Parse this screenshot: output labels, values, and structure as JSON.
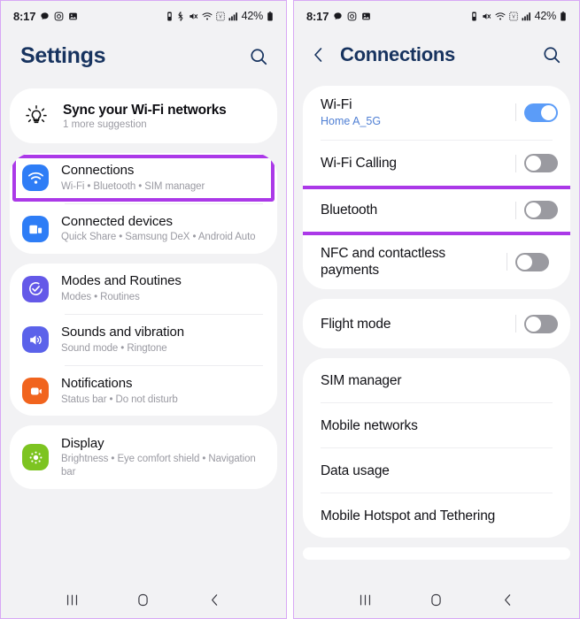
{
  "theme": {
    "accent_highlight": "#ab39e8",
    "panel_border": "#d8a8f5",
    "page_bg": "#f2f2f4",
    "card_bg": "#ffffff",
    "title_color": "#17335f",
    "toggle_on": "#5b9cf8",
    "toggle_off": "#9a9aa0",
    "subtitle_color": "#9a9aa2",
    "link_color": "#4f7fd4"
  },
  "left": {
    "status_bar": {
      "time": "8:17",
      "left_icons": [
        "chat-bubble-icon",
        "instagram-icon",
        "gallery-icon"
      ],
      "right_icons": [
        "alarm-icon",
        "bluetooth-icon",
        "mute-icon",
        "wifi-icon",
        "vpn-icon",
        "signal-bars-icon"
      ],
      "battery_percent": "42%",
      "battery_icon": "battery-icon"
    },
    "app_bar": {
      "title": "Settings",
      "search_icon": "search-icon"
    },
    "suggestion": {
      "icon": "lightbulb-icon",
      "title": "Sync your Wi-Fi networks",
      "subtitle": "1 more suggestion"
    },
    "groups": [
      {
        "rows": [
          {
            "icon": "wifi-icon",
            "icon_color": "#2e7df6",
            "title": "Connections",
            "subtitle": "Wi-Fi  •  Bluetooth  •  SIM manager",
            "highlighted": true
          },
          {
            "icon": "connected-devices-icon",
            "icon_color": "#2e7df6",
            "title": "Connected devices",
            "subtitle": "Quick Share  •  Samsung DeX  •  Android Auto",
            "highlighted": false
          }
        ]
      },
      {
        "rows": [
          {
            "icon": "modes-routines-icon",
            "icon_color": "#6459e8",
            "title": "Modes and Routines",
            "subtitle": "Modes  •  Routines",
            "highlighted": false
          },
          {
            "icon": "sound-icon",
            "icon_color": "#5b62ea",
            "title": "Sounds and vibration",
            "subtitle": "Sound mode  •  Ringtone",
            "highlighted": false
          },
          {
            "icon": "notifications-icon",
            "icon_color": "#f1641e",
            "title": "Notifications",
            "subtitle": "Status bar  •  Do not disturb",
            "highlighted": false
          }
        ]
      },
      {
        "rows": [
          {
            "icon": "display-icon",
            "icon_color": "#7dc421",
            "title": "Display",
            "subtitle": "Brightness  •  Eye comfort shield  •  Navigation bar",
            "highlighted": false
          }
        ]
      }
    ],
    "nav_bar": {
      "recents": "recents-icon",
      "home": "home-icon",
      "back": "back-icon"
    }
  },
  "right": {
    "status_bar": {
      "time": "8:17",
      "left_icons": [
        "chat-bubble-icon",
        "instagram-icon",
        "gallery-icon"
      ],
      "right_icons": [
        "alarm-icon",
        "mute-icon",
        "wifi-icon",
        "vpn-icon",
        "signal-bars-icon"
      ],
      "battery_percent": "42%",
      "battery_icon": "battery-icon"
    },
    "app_bar": {
      "back_icon": "back-icon",
      "title": "Connections",
      "search_icon": "search-icon"
    },
    "groups": [
      {
        "rows": [
          {
            "title": "Wi-Fi",
            "subtitle": "Home A_5G",
            "toggle": "on",
            "highlighted": false
          },
          {
            "title": "Wi-Fi Calling",
            "subtitle": "",
            "toggle": "off",
            "highlighted": false
          },
          {
            "title": "Bluetooth",
            "subtitle": "",
            "toggle": "off",
            "highlighted": true
          },
          {
            "title": "NFC and contactless payments",
            "subtitle": "",
            "toggle": "off",
            "highlighted": false
          }
        ]
      },
      {
        "rows": [
          {
            "title": "Flight mode",
            "subtitle": "",
            "toggle": "off",
            "highlighted": false
          }
        ]
      },
      {
        "rows": [
          {
            "title": "SIM manager",
            "subtitle": "",
            "toggle": "none",
            "highlighted": false
          },
          {
            "title": "Mobile networks",
            "subtitle": "",
            "toggle": "none",
            "highlighted": false
          },
          {
            "title": "Data usage",
            "subtitle": "",
            "toggle": "none",
            "highlighted": false
          },
          {
            "title": "Mobile Hotspot and Tethering",
            "subtitle": "",
            "toggle": "none",
            "highlighted": false
          }
        ]
      }
    ],
    "nav_bar": {
      "recents": "recents-icon",
      "home": "home-icon",
      "back": "back-icon"
    }
  }
}
